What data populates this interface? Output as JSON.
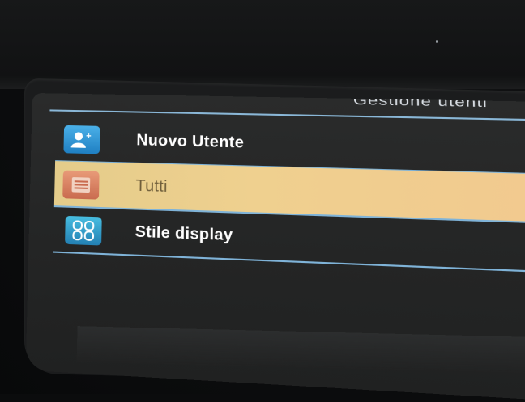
{
  "screen": {
    "title": "Gestione utenti",
    "menu": [
      {
        "label": "Nuovo Utente",
        "icon": "add-user-icon",
        "selected": false
      },
      {
        "label": "Tutti",
        "icon": "user-list-icon",
        "selected": true
      },
      {
        "label": "Stile display",
        "icon": "display-style-icon",
        "selected": false
      }
    ]
  },
  "colors": {
    "highlight": "#efd08f",
    "separator": "#7fb3d8",
    "screen_bg": "#252626"
  }
}
